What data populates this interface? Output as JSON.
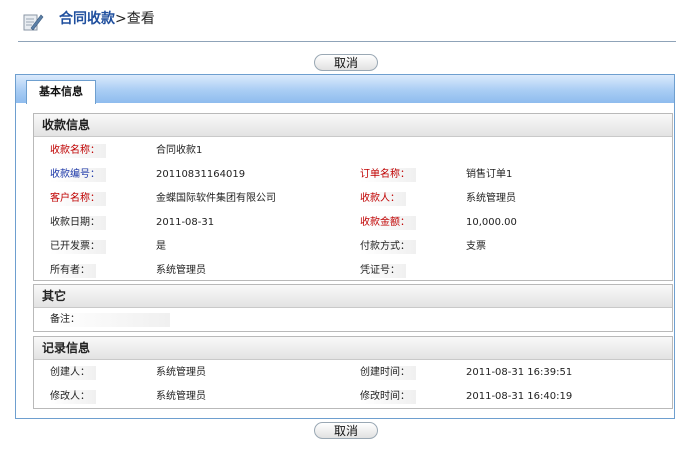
{
  "header": {
    "title_link": "合同收款",
    "title_rest": ">查看"
  },
  "buttons": {
    "cancel_top": "取消",
    "cancel_bottom": "取消"
  },
  "tab": {
    "label": "基本信息"
  },
  "sections": {
    "receipt": {
      "title": "收款信息",
      "rows": [
        {
          "label1": "收款名称：",
          "value1": "合同收款1"
        },
        {
          "label1": "收款编号：",
          "value1": "20110831164019",
          "label2": "订单名称：",
          "value2": "销售订单1"
        },
        {
          "label1": "客户名称：",
          "value1": "金蝶国际软件集团有限公司",
          "label2": "收款人：",
          "value2": "系统管理员"
        },
        {
          "label1": "收款日期：",
          "value1": "2011-08-31",
          "label2": "收款金额：",
          "value2": "10,000.00"
        },
        {
          "label1": "已开发票：",
          "value1": "是",
          "label2": "付款方式：",
          "value2": "支票"
        },
        {
          "label1": "所有者：",
          "value1": "系统管理员",
          "label2": "凭证号：",
          "value2": ""
        }
      ]
    },
    "other": {
      "title": "其它",
      "rows": [
        {
          "label1": "备注：",
          "value1": ""
        }
      ]
    },
    "record": {
      "title": "记录信息",
      "rows": [
        {
          "label1": "创建人：",
          "value1": "系统管理员",
          "label2": "创建时间：",
          "value2": "2011-08-31 16:39:51"
        },
        {
          "label1": "修改人：",
          "value1": "系统管理员",
          "label2": "修改时间：",
          "value2": "2011-08-31 16:40:19"
        }
      ]
    }
  },
  "colors": {
    "required_label": "#c00000",
    "link_label": "#1a36a8",
    "title_link": "#1f4f9e",
    "tab_bar": "#a9cdf4"
  }
}
